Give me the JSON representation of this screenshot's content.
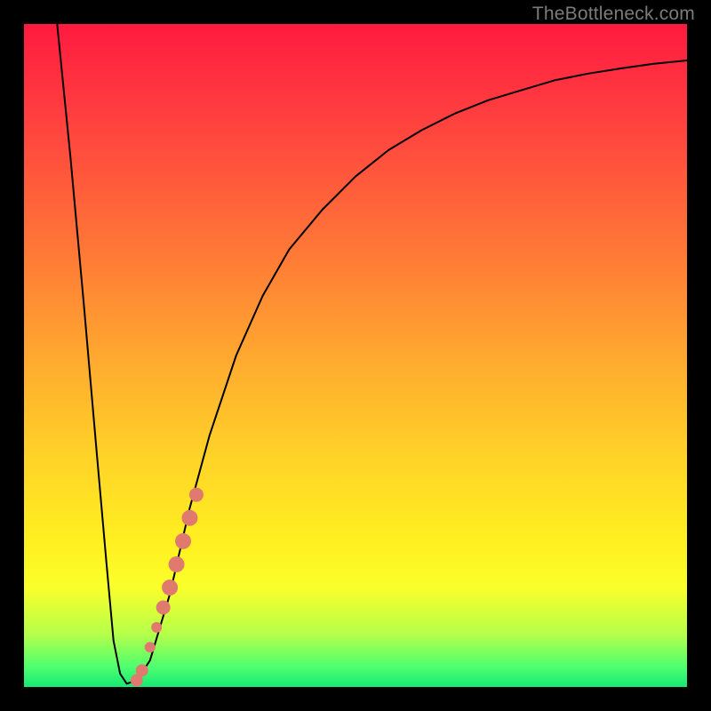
{
  "watermark": "TheBottleneck.com",
  "chart_data": {
    "type": "line",
    "title": "",
    "xlabel": "",
    "ylabel": "",
    "xlim": [
      0,
      100
    ],
    "ylim": [
      0,
      100
    ],
    "grid": false,
    "series": [
      {
        "name": "curve",
        "color": "#000000",
        "x": [
          5,
          7,
          9,
          11,
          12.5,
          13.5,
          14.5,
          15.5,
          17,
          19,
          22,
          25,
          28,
          32,
          36,
          40,
          45,
          50,
          55,
          60,
          65,
          70,
          75,
          80,
          85,
          90,
          95,
          100
        ],
        "y": [
          100,
          80,
          58,
          35,
          18,
          7,
          2,
          0.5,
          1,
          4,
          14,
          27,
          38,
          50,
          59,
          66,
          72,
          77,
          81,
          84,
          86.5,
          88.5,
          90,
          91.5,
          92.5,
          93.3,
          94,
          94.5
        ]
      }
    ],
    "markers": {
      "name": "highlighted-points",
      "color": "#e07a6f",
      "points": [
        {
          "x": 17.0,
          "y": 1.0,
          "r": 7
        },
        {
          "x": 17.8,
          "y": 2.5,
          "r": 7
        },
        {
          "x": 19.0,
          "y": 6.0,
          "r": 6
        },
        {
          "x": 20.0,
          "y": 9.0,
          "r": 6
        },
        {
          "x": 21.0,
          "y": 12.0,
          "r": 8
        },
        {
          "x": 22.0,
          "y": 15.0,
          "r": 9
        },
        {
          "x": 23.0,
          "y": 18.5,
          "r": 9
        },
        {
          "x": 24.0,
          "y": 22.0,
          "r": 9
        },
        {
          "x": 25.0,
          "y": 25.5,
          "r": 9
        },
        {
          "x": 26.0,
          "y": 29.0,
          "r": 8
        }
      ]
    }
  }
}
